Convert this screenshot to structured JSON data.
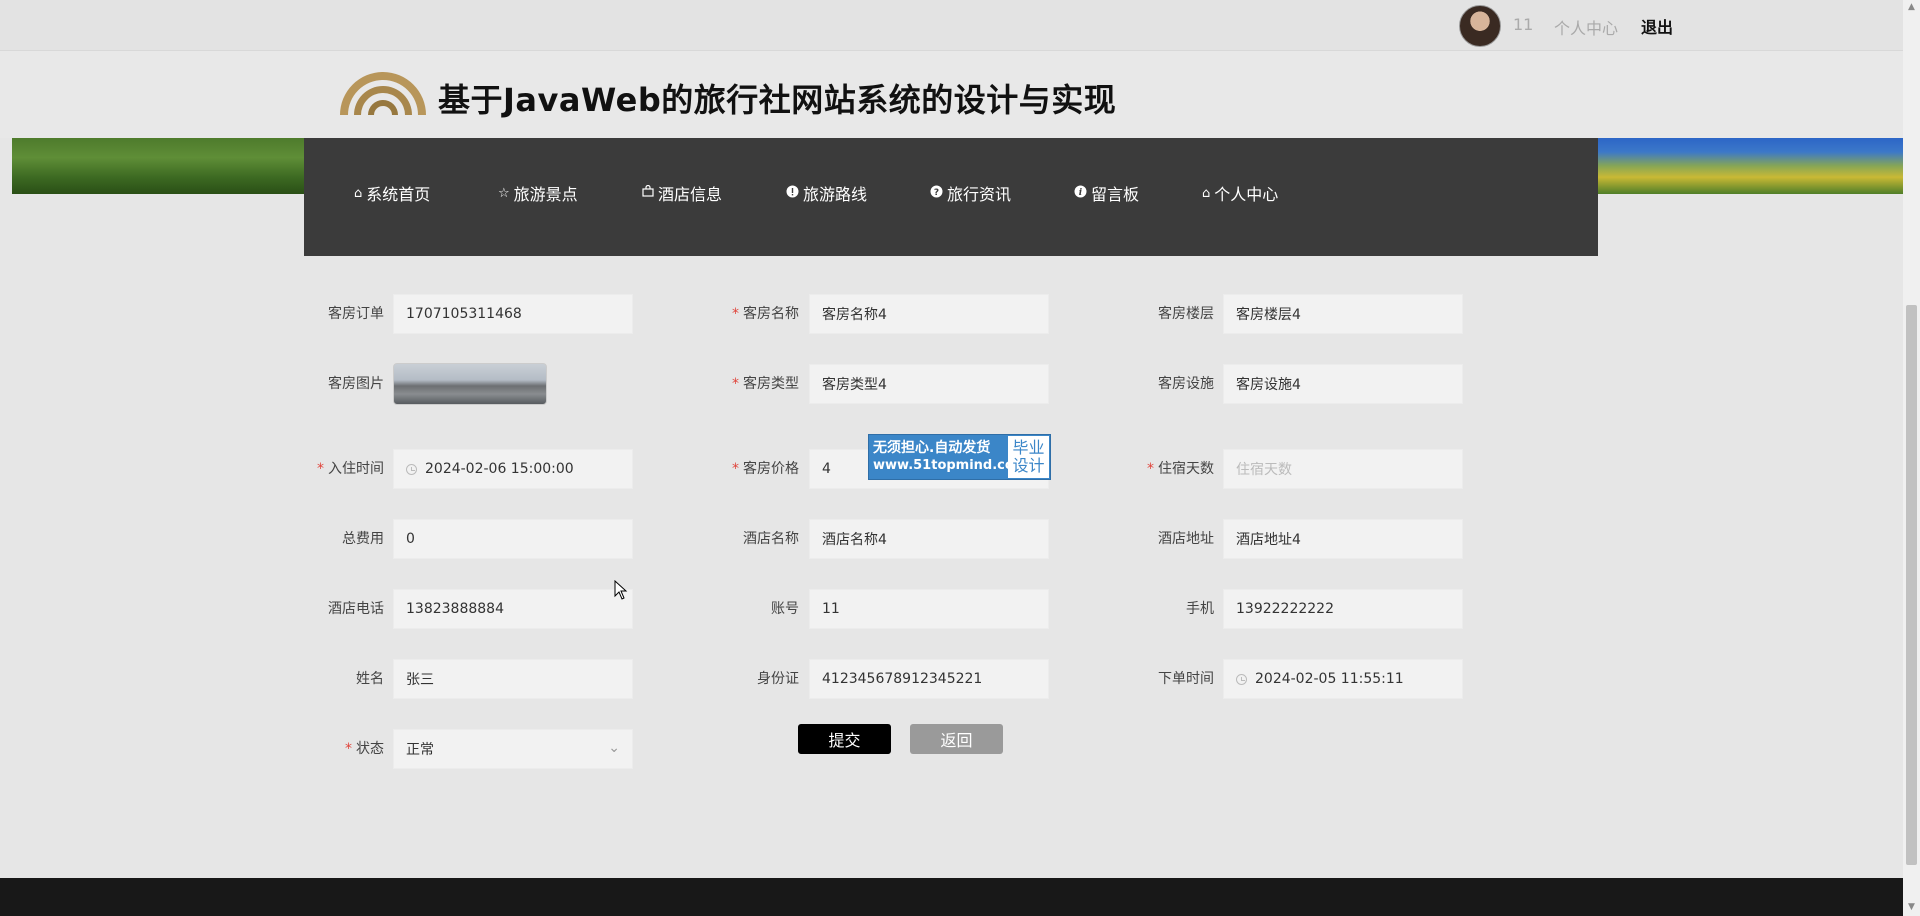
{
  "topbar": {
    "username": "11",
    "center_label": "个人中心",
    "logout_label": "退出"
  },
  "header": {
    "title": "基于JavaWeb的旅行社网站系统的设计与实现"
  },
  "nav": {
    "items": [
      {
        "icon": "home-icon",
        "glyph": "⌂",
        "label": "系统首页"
      },
      {
        "icon": "star-icon",
        "glyph": "☆",
        "label": "旅游景点"
      },
      {
        "icon": "bag-icon",
        "glyph": "🛍",
        "label": "酒店信息"
      },
      {
        "icon": "info-circle-icon",
        "glyph": "●",
        "label": "旅游路线"
      },
      {
        "icon": "question-circle-icon",
        "glyph": "?",
        "label": "旅行资讯"
      },
      {
        "icon": "info-icon",
        "glyph": "i",
        "label": "留言板"
      },
      {
        "icon": "home-icon",
        "glyph": "⌂",
        "label": "个人中心"
      }
    ]
  },
  "form": {
    "order_no": {
      "label": "客房订单",
      "value": "1707105311468"
    },
    "room_name": {
      "label": "客房名称",
      "value": "客房名称4"
    },
    "room_floor": {
      "label": "客房楼层",
      "value": "客房楼层4"
    },
    "room_image": {
      "label": "客房图片"
    },
    "room_type": {
      "label": "客房类型",
      "value": "客房类型4"
    },
    "room_facility": {
      "label": "客房设施",
      "value": "客房设施4"
    },
    "checkin_time": {
      "label": "入住时间",
      "value": "2024-02-06 15:00:00"
    },
    "room_price": {
      "label": "客房价格",
      "value": "4"
    },
    "stay_days": {
      "label": "住宿天数",
      "placeholder": "住宿天数"
    },
    "total_cost": {
      "label": "总费用",
      "value": "0"
    },
    "hotel_name": {
      "label": "酒店名称",
      "value": "酒店名称4"
    },
    "hotel_address": {
      "label": "酒店地址",
      "value": "酒店地址4"
    },
    "hotel_phone": {
      "label": "酒店电话",
      "value": "13823888884"
    },
    "account": {
      "label": "账号",
      "value": "11"
    },
    "mobile": {
      "label": "手机",
      "value": "13922222222"
    },
    "name": {
      "label": "姓名",
      "value": "张三"
    },
    "id_card": {
      "label": "身份证",
      "value": "412345678912345221"
    },
    "order_time": {
      "label": "下单时间",
      "value": "2024-02-05 11:55:11"
    },
    "status": {
      "label": "状态",
      "value": "正常"
    }
  },
  "buttons": {
    "submit": "提交",
    "back": "返回"
  },
  "watermark": {
    "line1": "无须担心.自动发货",
    "line2": "www.51topmind.com",
    "badge1": "毕业",
    "badge2": "设计"
  },
  "colors": {
    "nav_bg": "#3b3b3b",
    "required": "#e0443b",
    "submit_bg": "#000000",
    "back_bg": "#9a9a9a",
    "watermark_blue": "#3b86c8"
  }
}
